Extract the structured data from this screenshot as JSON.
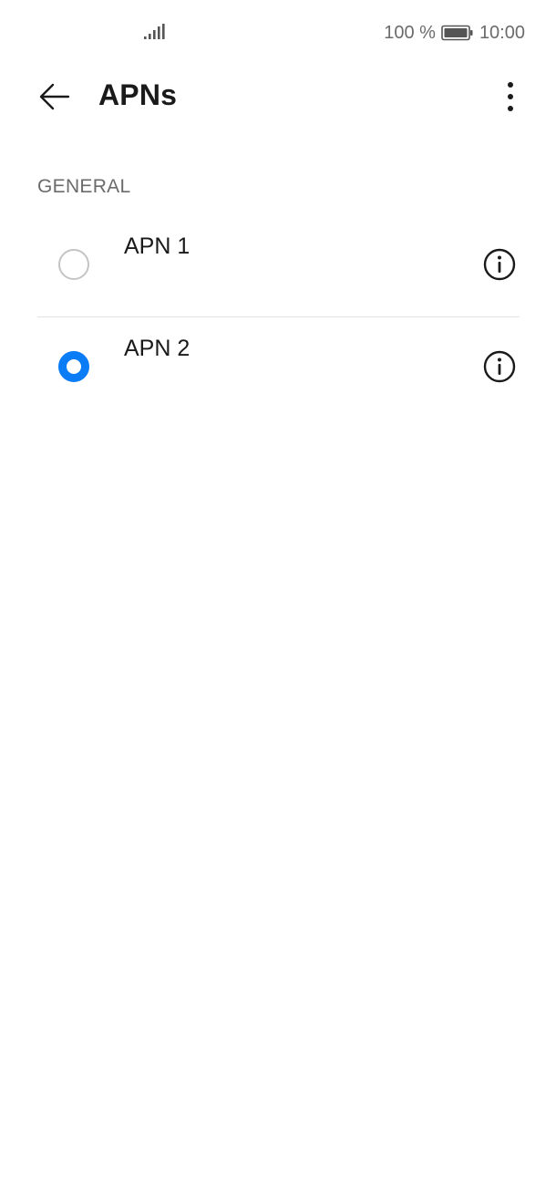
{
  "status_bar": {
    "signal_icon": "signal-strength-icon",
    "battery_percent": "100 %",
    "battery_icon": "battery-full-icon",
    "time": "10:00"
  },
  "header": {
    "back_icon": "arrow-left-icon",
    "title": "APNs",
    "more_icon": "more-vertical-icon"
  },
  "section": {
    "title": "GENERAL"
  },
  "apns": [
    {
      "name": "APN 1",
      "selected": false,
      "info_icon": "info-icon"
    },
    {
      "name": "APN 2",
      "selected": true,
      "info_icon": "info-icon"
    }
  ],
  "colors": {
    "accent": "#0a7cf5",
    "text_primary": "#1a1a1a",
    "text_secondary": "#6b6b6b",
    "divider": "#e2e2e2",
    "radio_off": "#c4c4c4"
  }
}
